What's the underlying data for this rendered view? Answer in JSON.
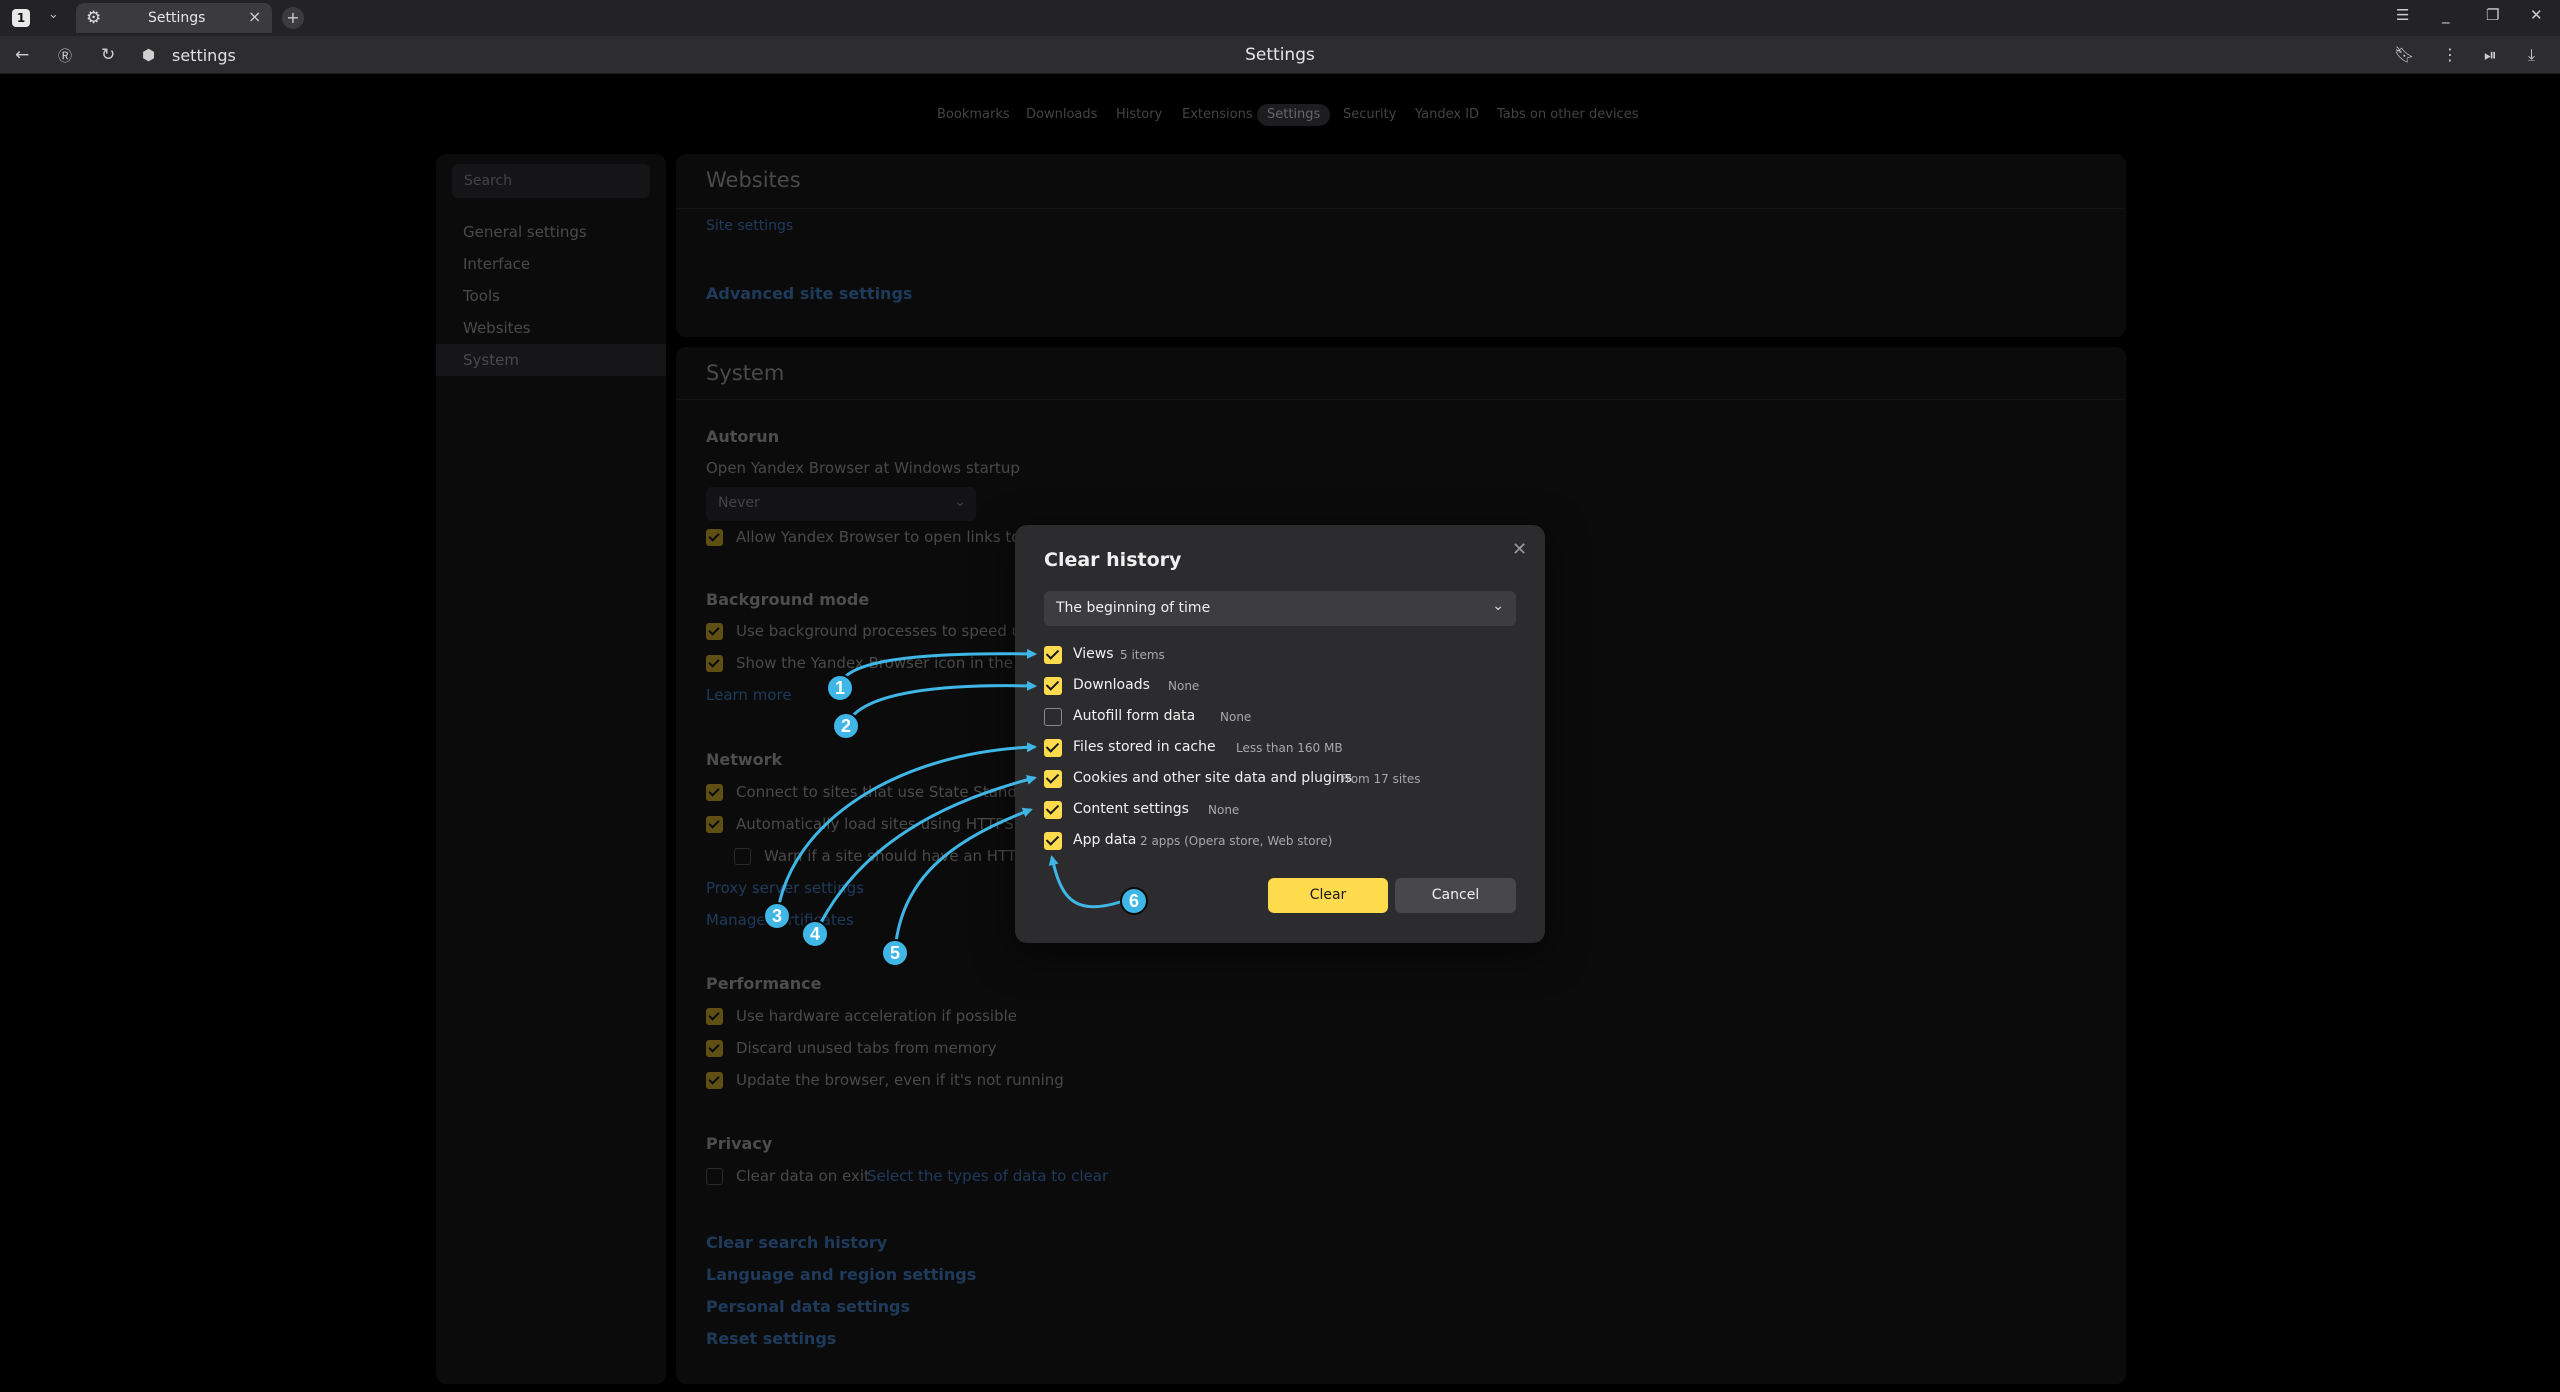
{
  "tabbar": {
    "tab_count": "1",
    "active_tab_title": "Settings",
    "icons": [
      "chevron-down-icon",
      "gear-icon",
      "close-icon",
      "plus-icon",
      "menu-icon",
      "minimize-icon",
      "restore-icon",
      "close-window-icon"
    ]
  },
  "addressbar": {
    "url": "settings",
    "page_title": "Settings"
  },
  "topnav": {
    "items": [
      "Bookmarks",
      "Downloads",
      "History",
      "Extensions",
      "Settings",
      "Security",
      "Yandex ID",
      "Tabs on other devices"
    ],
    "active": "Settings"
  },
  "sidebar": {
    "search_placeholder": "Search",
    "items": [
      "General settings",
      "Interface",
      "Tools",
      "Websites",
      "System"
    ],
    "active": "System"
  },
  "websites": {
    "title": "Websites",
    "site_settings": "Site settings",
    "advanced_site_settings": "Advanced site settings"
  },
  "system": {
    "title": "System",
    "autorun": {
      "heading": "Autorun",
      "label": "Open Yandex Browser at Windows startup",
      "select_value": "Never",
      "allow_links": "Allow Yandex Browser to open links to Yan"
    },
    "background": {
      "heading": "Background mode",
      "bg_processes": "Use background processes to speed up Ya",
      "tray_icon": "Show the Yandex Browser icon in the tray",
      "learn_more": "Learn more"
    },
    "network": {
      "heading": "Network",
      "connect": "Connect to sites that use State Standard",
      "https": "Automatically load sites using HTTPS if",
      "warn": "Warn if a site should have an HTTPS ve",
      "proxy": "Proxy server settings",
      "manage": "Manage certificates"
    },
    "performance": {
      "heading": "Performance",
      "hw_accel": "Use hardware acceleration if possible",
      "discard": "Discard unused tabs from memory",
      "update": "Update the browser, even if it's not running"
    },
    "privacy": {
      "heading": "Privacy",
      "clear_on_exit": "Clear data on exit",
      "select_types": "Select the types of data to clear"
    },
    "links": [
      "Clear search history",
      "Language and region settings",
      "Personal data settings",
      "Reset settings"
    ]
  },
  "dialog": {
    "title": "Clear history",
    "period": "The beginning of time",
    "options": [
      {
        "label": "Views",
        "detail": "5 items",
        "checked": true
      },
      {
        "label": "Downloads",
        "detail": "None",
        "checked": true
      },
      {
        "label": "Autofill form data",
        "detail": "None",
        "checked": false
      },
      {
        "label": "Files stored in cache",
        "detail": "Less than 160 MB",
        "checked": true
      },
      {
        "label": "Cookies and other site data and plugins",
        "detail": "From 17 sites",
        "checked": true
      },
      {
        "label": "Content settings",
        "detail": "None",
        "checked": true
      },
      {
        "label": "App data",
        "detail": "2 apps (Opera store, Web store)",
        "checked": true
      }
    ],
    "clear_label": "Clear",
    "cancel_label": "Cancel"
  },
  "annotations": {
    "markers": [
      "1",
      "2",
      "3",
      "4",
      "5",
      "6"
    ],
    "color": "#3fb6e6"
  },
  "colors": {
    "accent": "#ffdb4d",
    "dialog_bg": "#2c2c2e",
    "link": "#1f3b5c"
  }
}
